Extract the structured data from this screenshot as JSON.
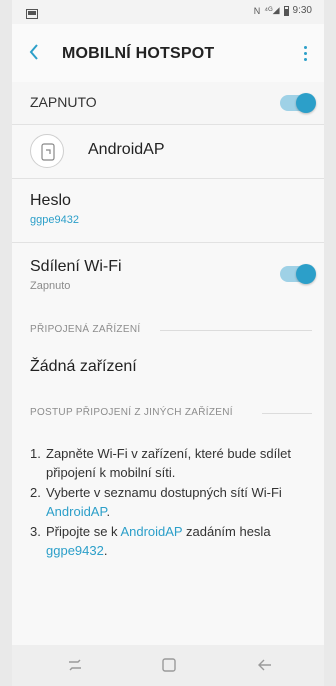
{
  "status_bar": {
    "time": "9:30",
    "left_icon": "gallery-icon",
    "right_icons": [
      "nfc-icon",
      "lte-signal-icon",
      "battery-icon"
    ]
  },
  "toolbar": {
    "title": "MOBILNÍ HOTSPOT",
    "back_icon": "back-chevron-icon",
    "more_icon": "more-vertical-icon"
  },
  "hotspot_toggle": {
    "label": "ZAPNUTO",
    "on": true
  },
  "ap_name": {
    "label": "AndroidAP",
    "icon": "device-icon"
  },
  "password": {
    "title": "Heslo",
    "value": "ggpe9432"
  },
  "wifi_sharing": {
    "title": "Sdílení Wi-Fi",
    "status": "Zapnuto",
    "on": true
  },
  "connected_devices": {
    "section_title": "PŘIPOJENÁ ZAŘÍZENÍ",
    "empty_text": "Žádná zařízení"
  },
  "instructions": {
    "section_title": "POSTUP PŘIPOJENÍ Z JINÝCH ZAŘÍZENÍ",
    "steps": [
      {
        "num": "1.",
        "text": "Zapněte Wi-Fi v zařízení, které bude sdílet připojení k mobilní síti."
      },
      {
        "num": "2.",
        "text_before": "Vyberte v seznamu dostupných sítí Wi-Fi",
        "link": "AndroidAP",
        "text_after": "."
      },
      {
        "num": "3.",
        "text_before": "Připojte se k",
        "link": "AndroidAP",
        "text_middle": "zadáním hesla",
        "link2": "ggpe9432",
        "text_after": "."
      }
    ]
  },
  "nav_bar": {
    "recents_icon": "recents-icon",
    "home_icon": "home-icon",
    "back_icon": "back-arrow-icon"
  },
  "colors": {
    "accent": "#2c9fc9",
    "background": "#f8f8f8"
  }
}
